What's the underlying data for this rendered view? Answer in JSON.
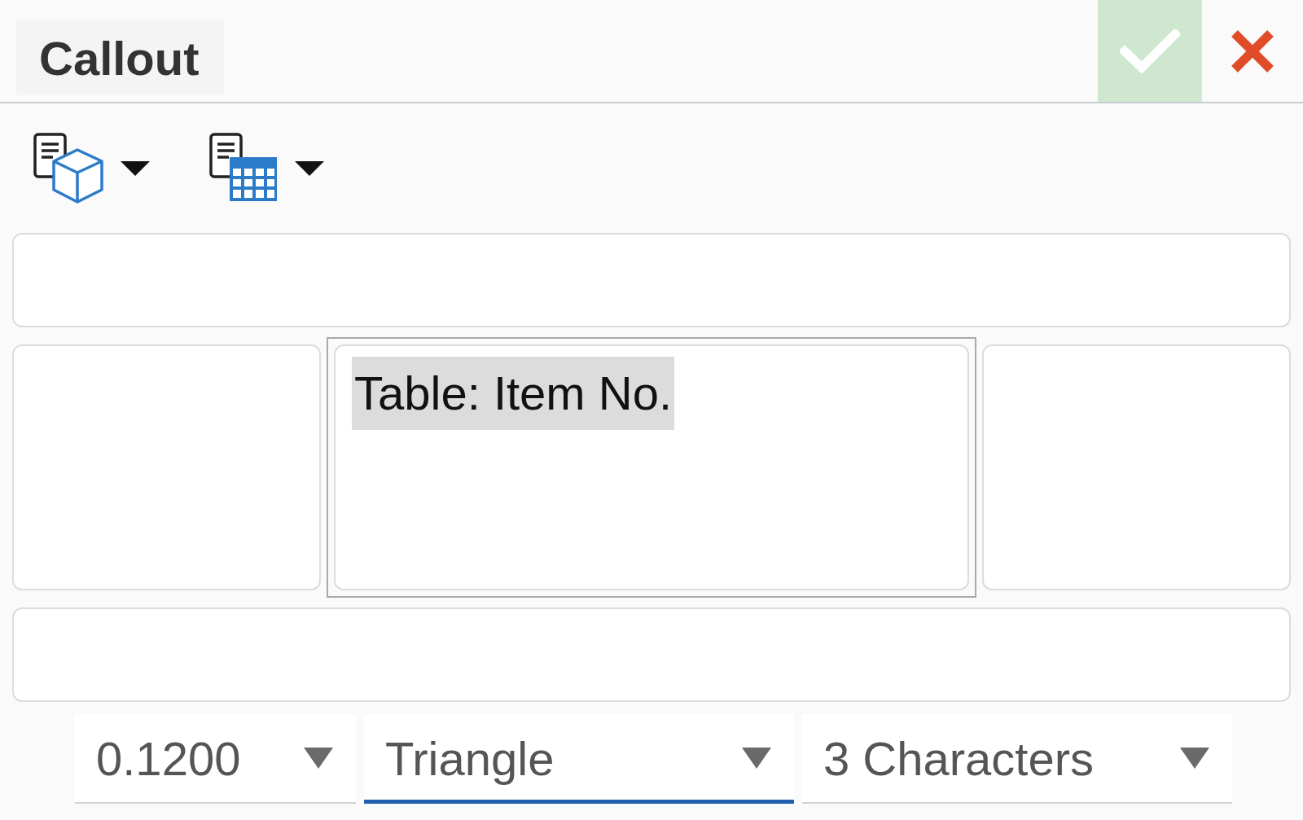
{
  "dialog": {
    "title": "Callout"
  },
  "callout": {
    "top": {
      "focused": false
    },
    "left": {
      "focused": false
    },
    "center": {
      "focused": true,
      "text": "Table: Item No.",
      "text_selected": true
    },
    "right": {
      "focused": false
    },
    "bottom": {
      "focused": false
    }
  },
  "dropdowns": [
    {
      "value": "0.1200",
      "focused": false
    },
    {
      "value": "Triangle",
      "focused": true
    },
    {
      "value": "3 Characters",
      "focused": false
    }
  ]
}
